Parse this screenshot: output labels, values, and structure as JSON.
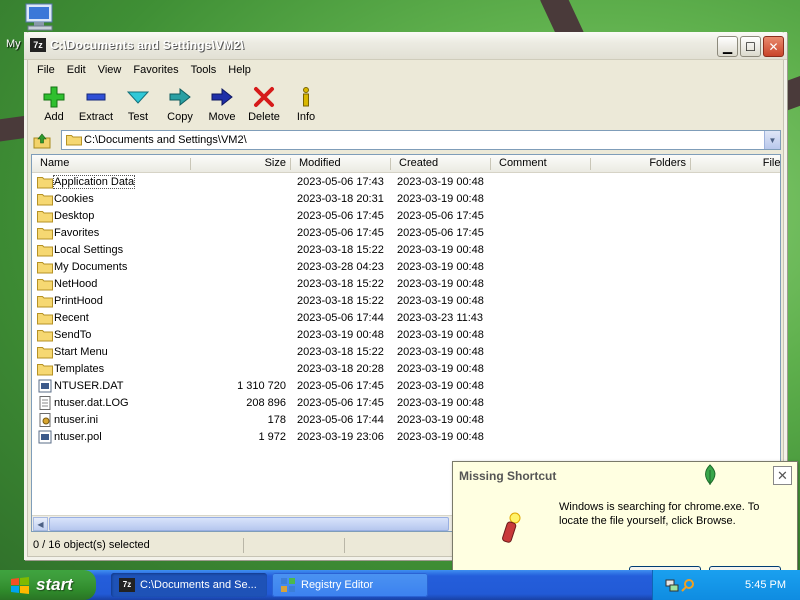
{
  "desktop": {
    "icon_label": "My"
  },
  "window": {
    "title": "C:\\Documents and Settings\\VM2\\",
    "app_icon_text": "7z"
  },
  "menu": [
    "File",
    "Edit",
    "View",
    "Favorites",
    "Tools",
    "Help"
  ],
  "toolbar": [
    {
      "label": "Add",
      "icon": "add-icon"
    },
    {
      "label": "Extract",
      "icon": "extract-icon"
    },
    {
      "label": "Test",
      "icon": "test-icon"
    },
    {
      "label": "Copy",
      "icon": "copy-icon"
    },
    {
      "label": "Move",
      "icon": "move-icon"
    },
    {
      "label": "Delete",
      "icon": "delete-icon"
    },
    {
      "label": "Info",
      "icon": "info-icon"
    }
  ],
  "address": {
    "path": "C:\\Documents and Settings\\VM2\\"
  },
  "columns": {
    "name": "Name",
    "size": "Size",
    "modified": "Modified",
    "created": "Created",
    "comment": "Comment",
    "folders": "Folders",
    "files": "Files"
  },
  "files": [
    {
      "name": "Application Data",
      "type": "folder",
      "size": "",
      "modified": "2023-05-06 17:43",
      "created": "2023-03-19 00:48"
    },
    {
      "name": "Cookies",
      "type": "folder",
      "size": "",
      "modified": "2023-03-18 20:31",
      "created": "2023-03-19 00:48"
    },
    {
      "name": "Desktop",
      "type": "folder",
      "size": "",
      "modified": "2023-05-06 17:45",
      "created": "2023-05-06 17:45"
    },
    {
      "name": "Favorites",
      "type": "folder",
      "size": "",
      "modified": "2023-05-06 17:45",
      "created": "2023-05-06 17:45"
    },
    {
      "name": "Local Settings",
      "type": "folder",
      "size": "",
      "modified": "2023-03-18 15:22",
      "created": "2023-03-19 00:48"
    },
    {
      "name": "My Documents",
      "type": "folder",
      "size": "",
      "modified": "2023-03-28 04:23",
      "created": "2023-03-19 00:48"
    },
    {
      "name": "NetHood",
      "type": "folder",
      "size": "",
      "modified": "2023-03-18 15:22",
      "created": "2023-03-19 00:48"
    },
    {
      "name": "PrintHood",
      "type": "folder",
      "size": "",
      "modified": "2023-03-18 15:22",
      "created": "2023-03-19 00:48"
    },
    {
      "name": "Recent",
      "type": "folder",
      "size": "",
      "modified": "2023-05-06 17:44",
      "created": "2023-03-23 11:43"
    },
    {
      "name": "SendTo",
      "type": "folder",
      "size": "",
      "modified": "2023-03-19 00:48",
      "created": "2023-03-19 00:48"
    },
    {
      "name": "Start Menu",
      "type": "folder",
      "size": "",
      "modified": "2023-03-18 15:22",
      "created": "2023-03-19 00:48"
    },
    {
      "name": "Templates",
      "type": "folder",
      "size": "",
      "modified": "2023-03-18 20:28",
      "created": "2023-03-19 00:48"
    },
    {
      "name": "NTUSER.DAT",
      "type": "dat",
      "size": "1 310 720",
      "modified": "2023-05-06 17:45",
      "created": "2023-03-19 00:48"
    },
    {
      "name": "ntuser.dat.LOG",
      "type": "log",
      "size": "208 896",
      "modified": "2023-05-06 17:45",
      "created": "2023-03-19 00:48"
    },
    {
      "name": "ntuser.ini",
      "type": "ini",
      "size": "178",
      "modified": "2023-05-06 17:44",
      "created": "2023-03-19 00:48"
    },
    {
      "name": "ntuser.pol",
      "type": "dat",
      "size": "1 972",
      "modified": "2023-03-19 23:06",
      "created": "2023-03-19 00:48"
    }
  ],
  "status": {
    "selection": "0 / 16 object(s) selected"
  },
  "popup": {
    "title": "Missing Shortcut",
    "message": "Windows is searching for chrome.exe. To locate the file yourself, click Browse."
  },
  "taskbar": {
    "start_label": "start",
    "tasks": [
      {
        "label": "C:\\Documents and Se...",
        "icon": "7zip-icon",
        "active": true
      },
      {
        "label": "Registry Editor",
        "icon": "registry-editor-icon",
        "active": false
      }
    ],
    "clock": "5:45 PM"
  },
  "colors": {
    "window_title_text": "#ffffff",
    "taskbar_blue": "#245edb",
    "start_green": "#3c9b3a",
    "popup_bg": "#ffffe1"
  }
}
